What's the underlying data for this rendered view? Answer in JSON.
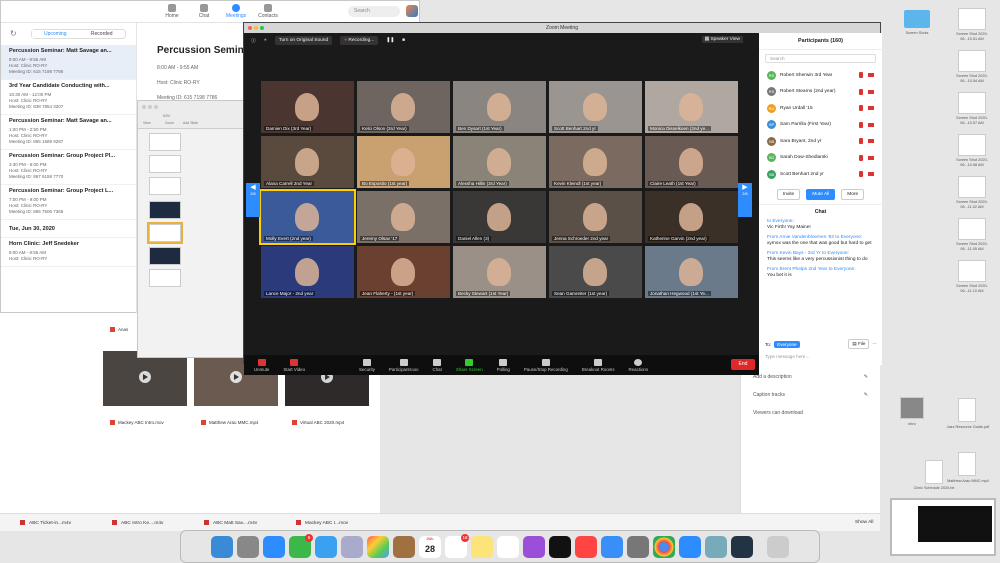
{
  "main": {
    "nav": [
      "Home",
      "Chat",
      "Meetings",
      "Contacts"
    ],
    "search_placeholder": "Search",
    "tabs": [
      "Upcoming",
      "Recorded"
    ],
    "meetings": [
      {
        "title": "Percussion Seminar: Matt Savage an...",
        "time": "8:00 AM - 9:55 AM",
        "host": "Host: Clinic RO-RY",
        "id": "Meeting ID: 615 7198 7786"
      },
      {
        "title": "3rd Year Candidate Conducting with...",
        "time": "10:30 AM - 12:00 PM",
        "host": "Host: Clinic RO-RY",
        "id": "Meeting ID: 838 7854 3207"
      },
      {
        "title": "Percussion Seminar: Matt Savage an...",
        "time": "1:00 PM - 2:50 PM",
        "host": "Host: Clinic RO-RY",
        "id": "Meeting ID: 865 1689 9287"
      },
      {
        "title": "Percussion Seminar: Group Project Pl...",
        "time": "3:30 PM - 6:00 PM",
        "host": "Host: Clinic RO-RY",
        "id": "Meeting ID: 867 6159 7770"
      },
      {
        "title": "Percussion Seminar: Group Project L...",
        "time": "7:00 PM - 9:00 PM",
        "host": "Host: Clinic RO-RY",
        "id": "Meeting ID: 865 7506 7365"
      }
    ],
    "date_header": "Tue, Jun 30, 2020",
    "last_meeting": {
      "title": "Horn Clinic: Jeff Snedeker",
      "time": "8:00 AM - 9:55 AM",
      "host": "Host: Clinic RO-RY"
    },
    "detail": {
      "title": "Percussion Seminar",
      "time": "8:00 AM - 9:55 AM",
      "host": "Host: Clinic RO-RY",
      "id": "Meeting ID: 615 7198 7786"
    }
  },
  "keynote": {
    "labels": [
      "View",
      "Zoom",
      "Add Slide"
    ],
    "zoom": "54%"
  },
  "meeting": {
    "window_title": "Zoom Meeting",
    "original_sound": "Turn on Original Sound",
    "recording": "Recording...",
    "speaker_view": "Speaker View",
    "page_left": "2/6",
    "page_right": "2/6",
    "tiles": [
      "Damien Dix (3rd Year)",
      "Kelci Olson (3rd Year)",
      "Ben Dysart (1st Year)",
      "Scott Benhart 2nd yr",
      "Monica Disselkoen (2nd ye...",
      "Alana Carrell 2nd Year",
      "Bo Esposito (1st year)",
      "Alexsha Hillis (3rd Year)",
      "Kevin Kleindl (1st year)",
      "Claire Leath (1st Year)",
      "Molly Evert (2nd year)",
      "Jeremy Olsav '17",
      "Daniel Allen (3)",
      "Jenna Schroeder 2nd year",
      "Katherine Garvin (2nd year)",
      "Lance Major - 2nd year",
      "Jean Flaherty - (1st year)",
      "Becky Stewart (1st Year)",
      "Sean Gamreiter (1st year)",
      "Jonathan Hegwood (1st Ye..."
    ],
    "controls": [
      "Unmute",
      "Start Video",
      "Security",
      "Participants",
      "Chat",
      "Share Screen",
      "Polling",
      "Pause/Stop Recording",
      "Breakout Rooms",
      "Reactions"
    ],
    "participant_count": "160",
    "end_label": "End"
  },
  "participants": {
    "header": "Participants (160)",
    "search": "Search",
    "list": [
      {
        "initials": "RS",
        "name": "Robert Sherwin 3rd Year",
        "color": "#5ab45a"
      },
      {
        "initials": "RS",
        "name": "Robert Stearns (2nd year)",
        "color": "#777777"
      },
      {
        "initials": "RU",
        "name": "Ryan Urdall '15",
        "color": "#f0a020"
      },
      {
        "initials": "SP",
        "name": "Sam Parrilla (First Year)",
        "color": "#3a8fd8"
      },
      {
        "initials": "SB",
        "name": "Sara Bryant, 2nd yr",
        "color": "#8a6a4a"
      },
      {
        "initials": "SD",
        "name": "Sarah Dow-Shedlarski",
        "color": "#5ab45a"
      },
      {
        "initials": "SB",
        "name": "Scott Benhart 2nd yr",
        "color": "#3aa060"
      }
    ],
    "buttons": [
      "Invite",
      "Mute All",
      "More"
    ]
  },
  "chat": {
    "header": "Chat",
    "messages": [
      {
        "from": "to Everyone:",
        "text": "Vic Firth!  Yay Maine!"
      },
      {
        "from": "From Arnie Vandenbloemen '93 to Everyone:",
        "text": "xymox was the one that was good but hard to get"
      },
      {
        "from": "From Kevin Bays - 3rd Yr to Everyone:",
        "text": "This seems like a very percussionist thing to do"
      },
      {
        "from": "From Brent Phelps 2nd Year to Everyone:",
        "text": "You bet it is"
      }
    ],
    "to_label": "To:",
    "to_value": "Everyone",
    "file_label": "File",
    "placeholder": "Type message here..."
  },
  "finder": {
    "files": [
      "Mackey ABC Intro.mov",
      "Matthew Arau MMC.mp4",
      "Virtual ABC 2020.mp4"
    ],
    "partial_file": "Anas",
    "right_rows": [
      "Add a description",
      "Caption tracks",
      "Viewers can download"
    ]
  },
  "downloads": {
    "items": [
      "ABC Ticket-in...m4v",
      "ABC Intro Ke....m4v",
      "ABC Matt Sav....m4v",
      "Mackey ABC I...mov"
    ],
    "show_all": "Show All"
  },
  "desktop": {
    "folder_label": "Screen Shots",
    "screenshots": [
      "Screen Shot 2020-06...10.51 AM",
      "Screen Shot 2020-06...10.54 AM",
      "Screen Shot 2020-06...10.57 AM",
      "Screen Shot 2020-06...10.58 AM",
      "Screen Shot 2020-06...11.02 AM",
      "Screen Shot 2020-06...11.05 AM",
      "Screen Shot 2020-06...11.10 AM"
    ],
    "intro_label": "intro",
    "doc_labels": [
      "Jazz Resource Guide.pdf",
      "Clinic Schedule 2020.txt",
      "Matthew Arau MMC.mp4"
    ]
  },
  "dock": {
    "calendar_day": "28",
    "badges": [
      "6",
      "18"
    ]
  }
}
